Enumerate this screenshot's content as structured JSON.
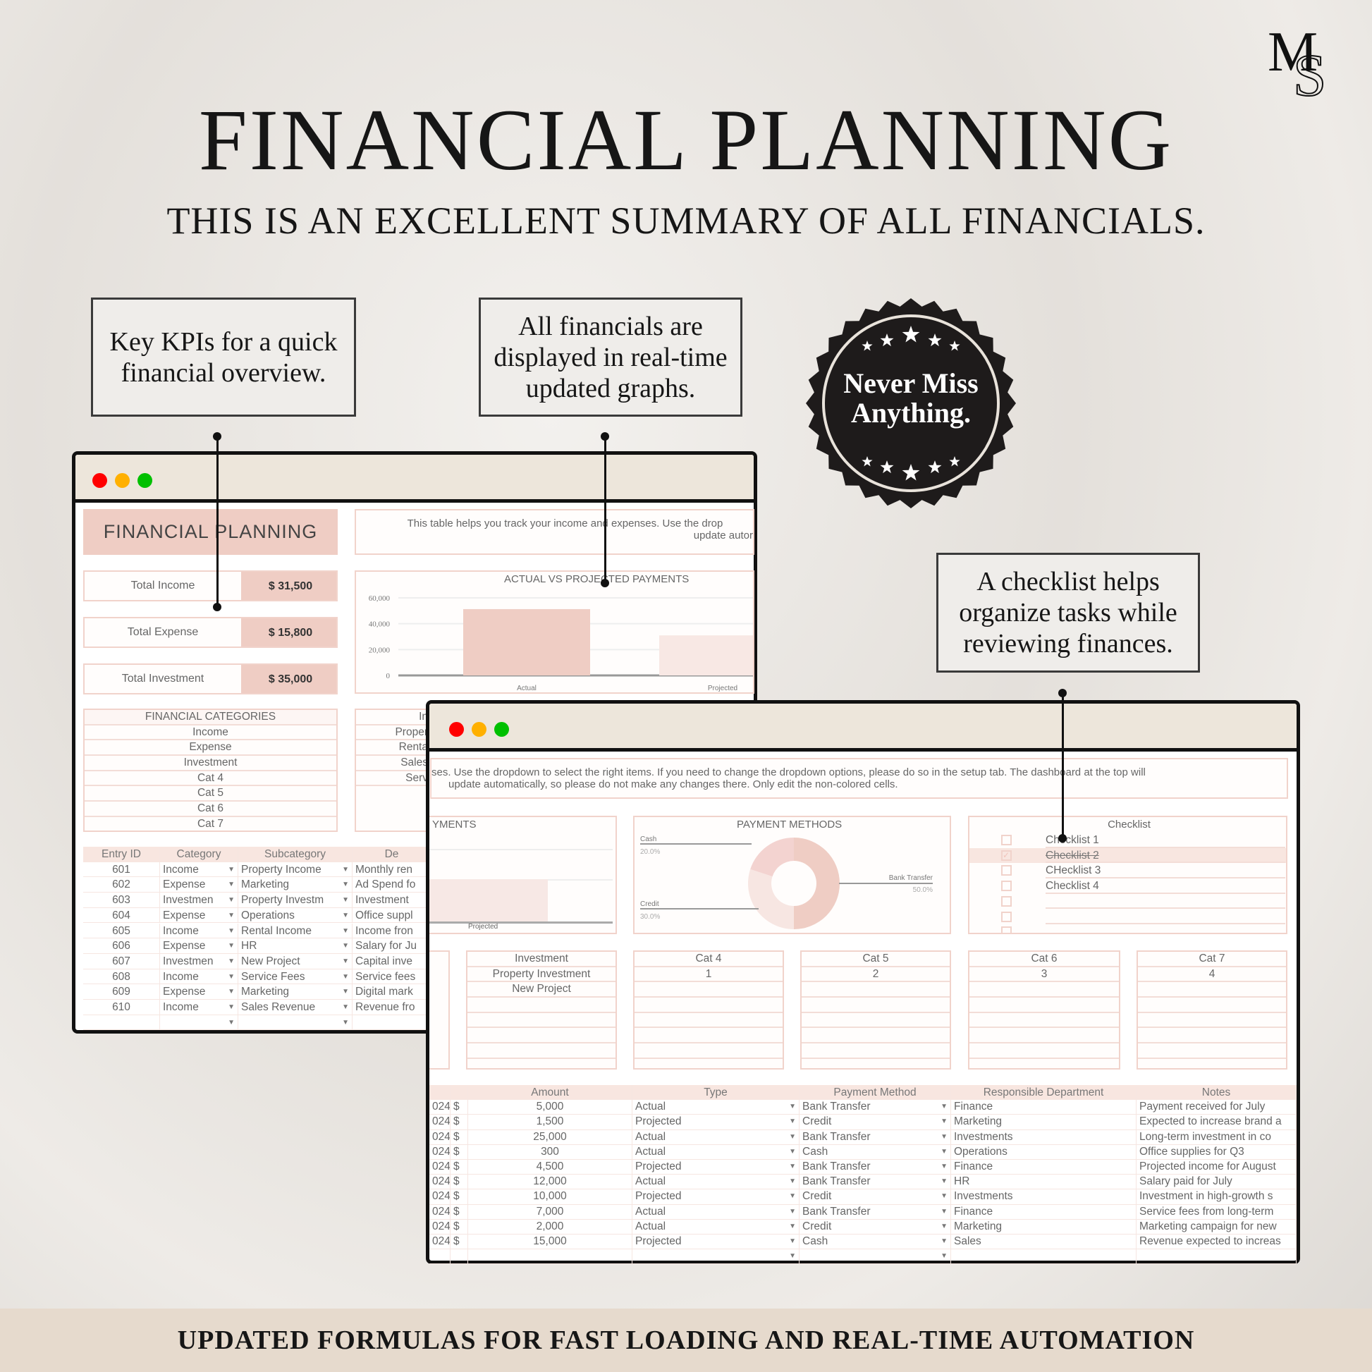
{
  "header": {
    "title": "FINANCIAL PLANNING",
    "subtitle": "THIS IS AN EXCELLENT SUMMARY OF ALL FINANCIALS.",
    "logo": "MS"
  },
  "callouts": [
    {
      "text": "Key KPIs for a quick financial overview."
    },
    {
      "text": "All financials are displayed in real-time updated graphs."
    },
    {
      "text": "A checklist helps organize tasks while reviewing finances."
    }
  ],
  "badge": {
    "line1": "Never Miss",
    "line2": "Anything."
  },
  "footer": {
    "text": "UPDATED FORMULAS FOR FAST LOADING AND REAL-TIME AUTOMATION"
  },
  "colors": {
    "accent": "#efcdc4",
    "border": "#f1d3cb",
    "window_bar": "#ede6db",
    "footer": "#e6dacd",
    "close": "#ff0000",
    "minimize": "#ffb000",
    "maximize": "#00c000"
  },
  "left_window": {
    "title": "FINANCIAL PLANNING",
    "description": [
      "This table helps you track your income and expenses. Use the drop",
      "update autor"
    ],
    "kpis": [
      {
        "label": "Total Income",
        "value": "$ 31,500"
      },
      {
        "label": "Total Expense",
        "value": "$ 15,800"
      },
      {
        "label": "Total Investment",
        "value": "$ 35,000"
      }
    ],
    "categories": {
      "title": "FINANCIAL CATEGORIES",
      "items": [
        "Income",
        "Expense",
        "Investment",
        "Cat 4",
        "Cat 5",
        "Cat 6",
        "Cat 7"
      ]
    },
    "income_column": [
      "In",
      "Proper",
      "Renta",
      "Sales",
      "Serv"
    ],
    "chart_data": {
      "type": "bar",
      "title": "ACTUAL VS PROJECTED PAYMENTS",
      "categories": [
        "Actual",
        "Projected"
      ],
      "values": [
        51300,
        31000
      ],
      "yticks": [
        "60,000",
        "40,000",
        "20,000",
        "0"
      ],
      "ylim": [
        0,
        60000
      ],
      "grid": true
    },
    "table": {
      "headers": [
        "Entry ID",
        "Category",
        "Subcategory",
        "De"
      ],
      "rows": [
        [
          "601",
          "Income",
          "Property Income",
          "Monthly ren"
        ],
        [
          "602",
          "Expense",
          "Marketing",
          "Ad Spend fo"
        ],
        [
          "603",
          "Investmen",
          "Property Investm",
          "Investment"
        ],
        [
          "604",
          "Expense",
          "Operations",
          "Office suppl"
        ],
        [
          "605",
          "Income",
          "Rental Income",
          "Income fron"
        ],
        [
          "606",
          "Expense",
          "HR",
          "Salary for Ju"
        ],
        [
          "607",
          "Investmen",
          "New Project",
          "Capital inve"
        ],
        [
          "608",
          "Income",
          "Service Fees",
          "Service fees"
        ],
        [
          "609",
          "Expense",
          "Marketing",
          "Digital mark"
        ],
        [
          "610",
          "Income",
          "Sales Revenue",
          "Revenue fro"
        ]
      ]
    }
  },
  "right_window": {
    "description": [
      "ses. Use the dropdown to select the right items. If you need to change the dropdown options, please do so in the setup tab. The dashboard at the top will",
      "update automatically, so please do not make any changes there. Only edit the non-colored cells."
    ],
    "payments_title": "YMENTS",
    "payments_label": "Projected",
    "payment_methods": {
      "title": "PAYMENT METHODS",
      "chart_data": {
        "type": "pie",
        "donut": true,
        "slices": [
          {
            "label": "Bank Transfer",
            "value": 50.0,
            "pct": "50.0%",
            "color": "#efcdc4"
          },
          {
            "label": "Credit",
            "value": 30.0,
            "pct": "30.0%",
            "color": "#f7e6e2"
          },
          {
            "label": "Cash",
            "value": 20.0,
            "pct": "20.0%",
            "color": "#f3d3d0"
          }
        ]
      }
    },
    "checklist": {
      "title": "Checklist",
      "items": [
        {
          "label": "Checklist 1",
          "checked": false
        },
        {
          "label": "Checklist 2",
          "checked": true
        },
        {
          "label": "CHecklist 3",
          "checked": false
        },
        {
          "label": "Checklist 4",
          "checked": false
        }
      ]
    },
    "cat_boxes": [
      {
        "title": "Investment",
        "items": [
          "Property Investment",
          "New Project"
        ]
      },
      {
        "title": "Cat 4",
        "items": [
          "1"
        ]
      },
      {
        "title": "Cat 5",
        "items": [
          "2"
        ]
      },
      {
        "title": "Cat 6",
        "items": [
          "3"
        ]
      },
      {
        "title": "Cat 7",
        "items": [
          "4"
        ]
      }
    ],
    "table": {
      "headers": [
        "",
        "",
        "Amount",
        "Type",
        "Payment Method",
        "Responsible Department",
        "Notes"
      ],
      "rows": [
        [
          "024",
          "$",
          "5,000",
          "Actual",
          "Bank Transfer",
          "Finance",
          "Payment received for July"
        ],
        [
          "024",
          "$",
          "1,500",
          "Projected",
          "Credit",
          "Marketing",
          "Expected to increase brand a"
        ],
        [
          "024",
          "$",
          "25,000",
          "Actual",
          "Bank Transfer",
          "Investments",
          "Long-term investment in co"
        ],
        [
          "024",
          "$",
          "300",
          "Actual",
          "Cash",
          "Operations",
          "Office supplies for Q3"
        ],
        [
          "024",
          "$",
          "4,500",
          "Projected",
          "Bank Transfer",
          "Finance",
          "Projected income for August"
        ],
        [
          "024",
          "$",
          "12,000",
          "Actual",
          "Bank Transfer",
          "HR",
          "Salary paid for July"
        ],
        [
          "024",
          "$",
          "10,000",
          "Projected",
          "Credit",
          "Investments",
          "Investment in high-growth s"
        ],
        [
          "024",
          "$",
          "7,000",
          "Actual",
          "Bank Transfer",
          "Finance",
          "Service fees from long-term"
        ],
        [
          "024",
          "$",
          "2,000",
          "Actual",
          "Credit",
          "Marketing",
          "Marketing campaign for new"
        ],
        [
          "024",
          "$",
          "15,000",
          "Projected",
          "Cash",
          "Sales",
          "Revenue expected to increas"
        ]
      ]
    }
  }
}
